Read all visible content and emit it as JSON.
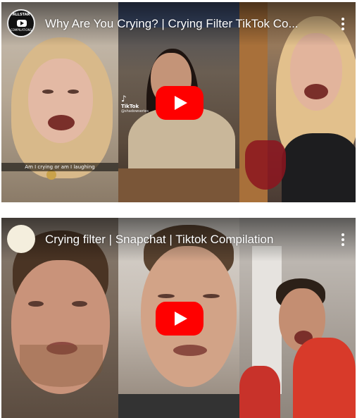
{
  "embeds": [
    {
      "channel_avatar_line1": "ALLSTAR",
      "channel_avatar_line2": "COMPILATIONS",
      "title": "Why Are You Crying? | Crying Filter TikTok Co...",
      "caption": "Am I crying or am I laughing",
      "watermark": {
        "glyph": "♪",
        "name": "TikTok",
        "handle": "@shadowseries"
      },
      "play_icon": "play-icon",
      "menu_icon": "more-vert-icon"
    },
    {
      "title": "Crying filter | Snapchat | Tiktok Compilation",
      "play_icon": "play-icon",
      "menu_icon": "more-vert-icon"
    }
  ],
  "colors": {
    "play_button": "#ff0000",
    "title_text": "#ffffff",
    "page_background": "#ffffff"
  }
}
